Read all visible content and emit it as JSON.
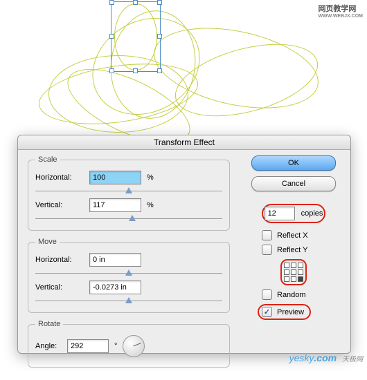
{
  "watermark_top": {
    "line1": "网页教学网",
    "line2": "WWW.WEBJX.COM"
  },
  "watermark_bottom": {
    "text": "yesky",
    "suffix": ".com",
    "cn": "天极网"
  },
  "dialog": {
    "title": "Transform Effect"
  },
  "scale": {
    "legend": "Scale",
    "h_label": "Horizontal:",
    "h_value": "100",
    "h_unit": "%",
    "v_label": "Vertical:",
    "v_value": "117",
    "v_unit": "%"
  },
  "move": {
    "legend": "Move",
    "h_label": "Horizontal:",
    "h_value": "0 in",
    "v_label": "Vertical:",
    "v_value": "-0.0273 in"
  },
  "rotate": {
    "legend": "Rotate",
    "a_label": "Angle:",
    "a_value": "292",
    "a_unit": "°"
  },
  "buttons": {
    "ok": "OK",
    "cancel": "Cancel"
  },
  "copies": {
    "value": "12",
    "label": "copies"
  },
  "options": {
    "reflect_x": "Reflect X",
    "reflect_y": "Reflect Y",
    "random": "Random",
    "preview": "Preview"
  }
}
